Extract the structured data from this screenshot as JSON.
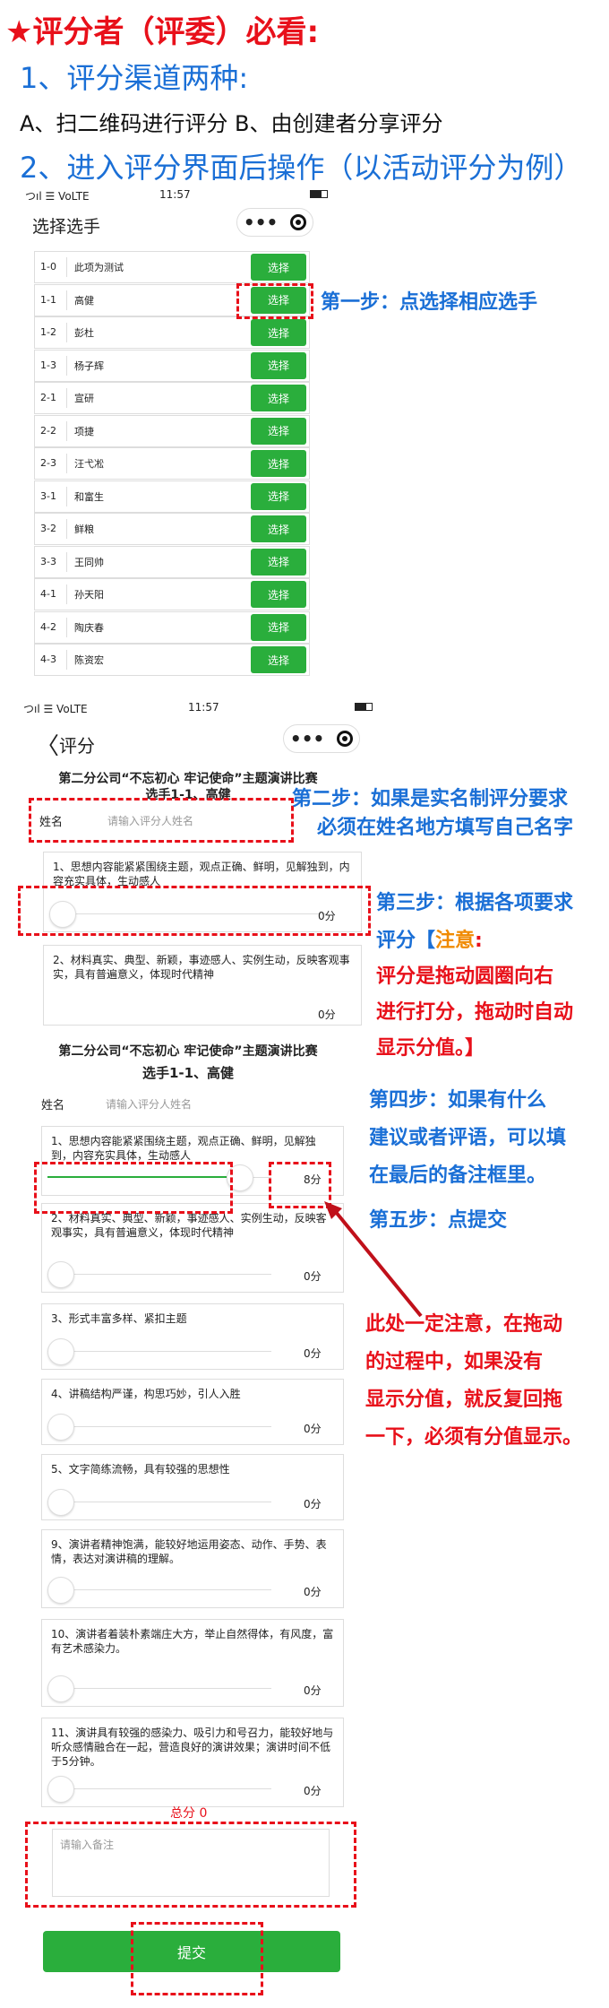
{
  "header": {
    "title": "★评分者（评委）必看:",
    "item1": "1、评分渠道两种:",
    "item1_options": "A、扫二维码进行评分  B、由创建者分享评分",
    "item2": "2、进入评分界面后操作（以活动评分为例）"
  },
  "phone1": {
    "status_left": "つıl ☰ VoLTE",
    "status_time": "11:57",
    "nav_title": "选择选手",
    "capsule_dots": "•••",
    "select_label": "选择",
    "contestants": [
      {
        "code": "1-0",
        "name": "此项为测试"
      },
      {
        "code": "1-1",
        "name": "高健"
      },
      {
        "code": "1-2",
        "name": "彭杜"
      },
      {
        "code": "1-3",
        "name": "杨子辉"
      },
      {
        "code": "2-1",
        "name": "宣研"
      },
      {
        "code": "2-2",
        "name": "项捷"
      },
      {
        "code": "2-3",
        "name": "汪弋凇"
      },
      {
        "code": "3-1",
        "name": "和富生"
      },
      {
        "code": "3-2",
        "name": "鲜粮"
      },
      {
        "code": "3-3",
        "name": "王同帅"
      },
      {
        "code": "4-1",
        "name": "孙天阳"
      },
      {
        "code": "4-2",
        "name": "陶庆春"
      },
      {
        "code": "4-3",
        "name": "陈资宏"
      }
    ]
  },
  "annotations": {
    "step1": "第一步：点选择相应选手",
    "step2_line1": "第二步：如果是实名制评分要求",
    "step2_line2": "必须在姓名地方填写自己名字",
    "step3_line1": "第三步：根据各项要求",
    "step3_line2_a": "评分【",
    "step3_line2_b": "注意",
    "step3_line2_c": ":",
    "step3_line3": "评分是拖动圆圈向右",
    "step3_line4": "进行打分，拖动时自动",
    "step3_line5": "显示分值。】",
    "step4_line1": "第四步：如果有什么",
    "step4_line2": "建议或者评语，可以填",
    "step4_line3": "在最后的备注框里。",
    "step5": "第五步：点提交",
    "warn_line1": "此处一定注意，在拖动",
    "warn_line2": "的过程中，如果没有",
    "warn_line3": "显示分值，就反复回拖",
    "warn_line4": "一下，必须有分值显示。"
  },
  "phone2": {
    "status_left": "つıl ☰ VoLTE",
    "status_time": "11:57",
    "back": "〈",
    "nav_title": "评分",
    "capsule_dots": "•••",
    "form_title_1": "第二分公司“不忘初心 牢记使命”主题演讲比赛",
    "form_title_2": "选手1-1、高健",
    "name_label": "姓名",
    "name_placeholder": "请输入评分人姓名",
    "q1": "1、思想内容能紧紧围绕主题，观点正确、鲜明，见解独到，内容充实具体，生动感人",
    "q2": "2、材料真实、典型、新颖，事迹感人、实例生动，反映客观事实，具有普遍意义，体现时代精神",
    "score_zero": "0分"
  },
  "phone3": {
    "form_title_1": "第二分公司“不忘初心 牢记使命”主题演讲比赛",
    "form_title_2": "选手1-1、高健",
    "name_label": "姓名",
    "name_placeholder": "请输入评分人姓名",
    "questions": [
      {
        "text": "1、思想内容能紧紧围绕主题，观点正确、鲜明，见解独到，内容充实具体，生动感人",
        "score": "8分",
        "progress": 0.8
      },
      {
        "text": "2、材料真实、典型、新颖，事迹感人、实例生动，反映客观事实，具有普遍意义，体现时代精神",
        "score": "0分",
        "progress": 0
      },
      {
        "text": "3、形式丰富多样、紧扣主题",
        "score": "0分",
        "progress": 0
      },
      {
        "text": "4、讲稿结构严谨，构思巧妙，引人入胜",
        "score": "0分",
        "progress": 0
      },
      {
        "text": "5、文字简练流畅，具有较强的思想性",
        "score": "0分",
        "progress": 0
      },
      {
        "text": "9、演讲者精神饱满，能较好地运用姿态、动作、手势、表情，表达对演讲稿的理解。",
        "score": "0分",
        "progress": 0
      },
      {
        "text": "10、演讲者着装朴素端庄大方，举止自然得体，有风度，富有艺术感染力。",
        "score": "0分",
        "progress": 0
      },
      {
        "text": "11、演讲具有较强的感染力、吸引力和号召力，能较好地与听众感情融合在一起，营造良好的演讲效果；演讲时间不低于5分钟。",
        "score": "0分",
        "progress": 0
      }
    ],
    "total": "总分 0",
    "remark_placeholder": "请输入备注",
    "submit": "提交"
  },
  "colors": {
    "accent_red": "#e8101a",
    "step_blue": "#1a6fd6",
    "button_green": "#2aae3c",
    "note_orange": "#f08a00"
  }
}
